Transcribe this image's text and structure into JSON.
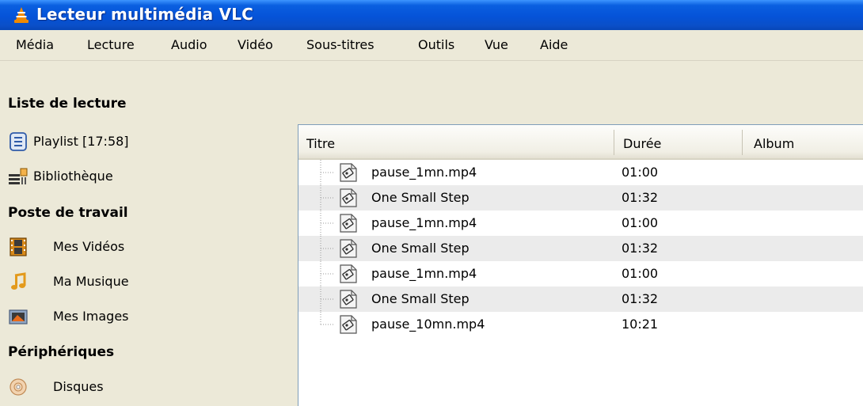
{
  "window": {
    "title": "Lecteur multimédia VLC"
  },
  "menu": [
    "Média",
    "Lecture",
    "Audio",
    "Vidéo",
    "Sous-titres",
    "Outils",
    "Vue",
    "Aide"
  ],
  "sidebar": {
    "headers": [
      "Liste de lecture",
      "Poste de travail",
      "Périphériques"
    ],
    "items": [
      {
        "label": "Playlist [17:58]",
        "icon": "playlist-icon"
      },
      {
        "label": "Bibliothèque",
        "icon": "library-icon"
      },
      {
        "label": "Mes Vidéos",
        "icon": "film-icon"
      },
      {
        "label": "Ma Musique",
        "icon": "music-note-icon"
      },
      {
        "label": "Mes Images",
        "icon": "picture-icon"
      },
      {
        "label": "Disques",
        "icon": "disc-icon"
      }
    ]
  },
  "playlist": {
    "columns": [
      "Titre",
      "Durée",
      "Album"
    ],
    "rows": [
      {
        "title": "pause_1mn.mp4",
        "duration": "01:00"
      },
      {
        "title": "One Small Step",
        "duration": "01:32"
      },
      {
        "title": "pause_1mn.mp4",
        "duration": "01:00"
      },
      {
        "title": "One Small Step",
        "duration": "01:32"
      },
      {
        "title": "pause_1mn.mp4",
        "duration": "01:00"
      },
      {
        "title": "One Small Step",
        "duration": "01:32"
      },
      {
        "title": "pause_10mn.mp4",
        "duration": "10:21"
      }
    ]
  },
  "colors": {
    "titlebar": "#0553d8",
    "vlc_orange": "#f08a00"
  }
}
